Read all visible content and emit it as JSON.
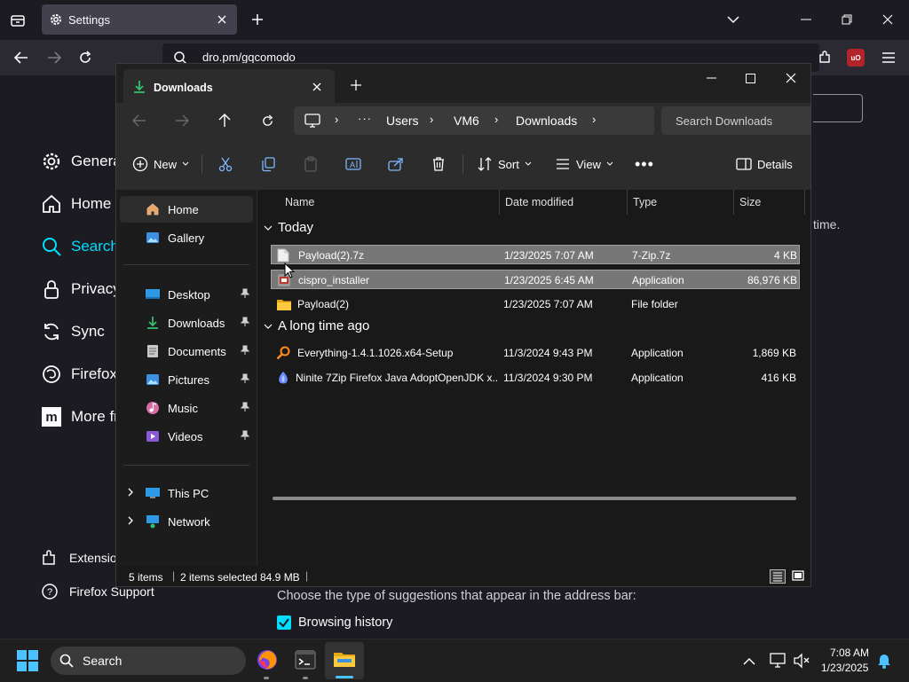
{
  "browser": {
    "tab_title": "Settings",
    "url": "dro.pm/gqcomodo",
    "extension_badge": "uO"
  },
  "settings": {
    "nav": [
      {
        "label": "General",
        "icon": "gear-icon"
      },
      {
        "label": "Home",
        "icon": "home-icon"
      },
      {
        "label": "Search",
        "icon": "search-icon"
      },
      {
        "label": "Privacy",
        "icon": "lock-icon"
      },
      {
        "label": "Sync",
        "icon": "sync-icon"
      },
      {
        "label": "Firefox",
        "icon": "firefox-icon"
      },
      {
        "label": "More fr",
        "icon": "mozilla-icon"
      }
    ],
    "extensions_label": "Extension",
    "support_label": "Firefox Support",
    "right_fragment": "time.",
    "suggestions_text": "Choose the type of suggestions that appear in the address bar:",
    "browsing_history_label": "Browsing history"
  },
  "explorer": {
    "tab_title": "Downloads",
    "breadcrumb": [
      "Users",
      "VM6",
      "Downloads"
    ],
    "search_placeholder": "Search Downloads",
    "commands": {
      "new": "New",
      "sort": "Sort",
      "view": "View",
      "details": "Details"
    },
    "nav": {
      "home": "Home",
      "gallery": "Gallery",
      "desktop": "Desktop",
      "downloads": "Downloads",
      "documents": "Documents",
      "pictures": "Pictures",
      "music": "Music",
      "videos": "Videos",
      "this_pc": "This PC",
      "network": "Network"
    },
    "columns": {
      "name": "Name",
      "date": "Date modified",
      "type": "Type",
      "size": "Size"
    },
    "groups": {
      "today": "Today",
      "long_ago": "A long time ago"
    },
    "files": [
      {
        "name": "Payload(2).7z",
        "date": "1/23/2025 7:07 AM",
        "type": "7-Zip.7z",
        "size": "4 KB",
        "icon": "file-icon",
        "selected": true
      },
      {
        "name": "cispro_installer",
        "date": "1/23/2025 6:45 AM",
        "type": "Application",
        "size": "86,976 KB",
        "icon": "installer-icon",
        "selected": true
      },
      {
        "name": "Payload(2)",
        "date": "1/23/2025 7:07 AM",
        "type": "File folder",
        "size": "",
        "icon": "folder-icon",
        "selected": false
      },
      {
        "name": "Everything-1.4.1.1026.x64-Setup",
        "date": "11/3/2024 9:43 PM",
        "type": "Application",
        "size": "1,869 KB",
        "icon": "magnifier-app-icon",
        "selected": false
      },
      {
        "name": "Ninite 7Zip Firefox Java AdoptOpenJDK x...",
        "date": "11/3/2024 9:30 PM",
        "type": "Application",
        "size": "416 KB",
        "icon": "ninite-icon",
        "selected": false
      }
    ],
    "status": {
      "items": "5 items",
      "selected": "2 items selected",
      "size": "84.9 MB"
    }
  },
  "taskbar": {
    "search_label": "Search",
    "time": "7:08 AM",
    "date": "1/23/2025"
  },
  "colors": {
    "accent_cyan": "#00ddff",
    "selection": "#777777",
    "checkbox": "#00ddff"
  }
}
